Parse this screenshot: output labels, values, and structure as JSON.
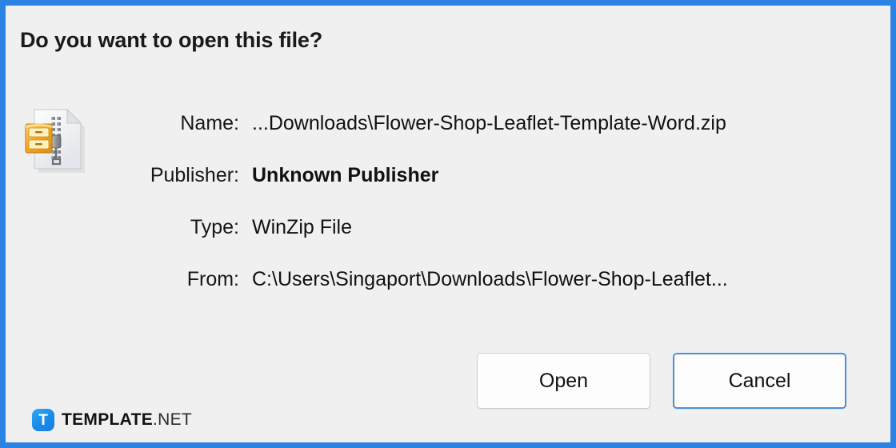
{
  "window": {
    "frame_color": "#2b82e3",
    "background_color": "#f0f0f0"
  },
  "dialog": {
    "title": "Do you want to open this file?",
    "icon": "winzip-file-icon",
    "fields": [
      {
        "label": "Name:",
        "value": "...Downloads\\Flower-Shop-Leaflet-Template-Word.zip",
        "bold": false
      },
      {
        "label": "Publisher:",
        "value": "Unknown Publisher",
        "bold": true
      },
      {
        "label": "Type:",
        "value": "WinZip File",
        "bold": false
      },
      {
        "label": "From:",
        "value": "C:\\Users\\Singaport\\Downloads\\Flower-Shop-Leaflet...",
        "bold": false
      }
    ],
    "buttons": {
      "open_label": "Open",
      "cancel_label": "Cancel",
      "focus_color": "#4a90d9"
    }
  },
  "brand": {
    "mark_letter": "T",
    "mark_color": "#1a8ae8",
    "name_strong": "TEMPLATE",
    "name_light": ".NET"
  }
}
